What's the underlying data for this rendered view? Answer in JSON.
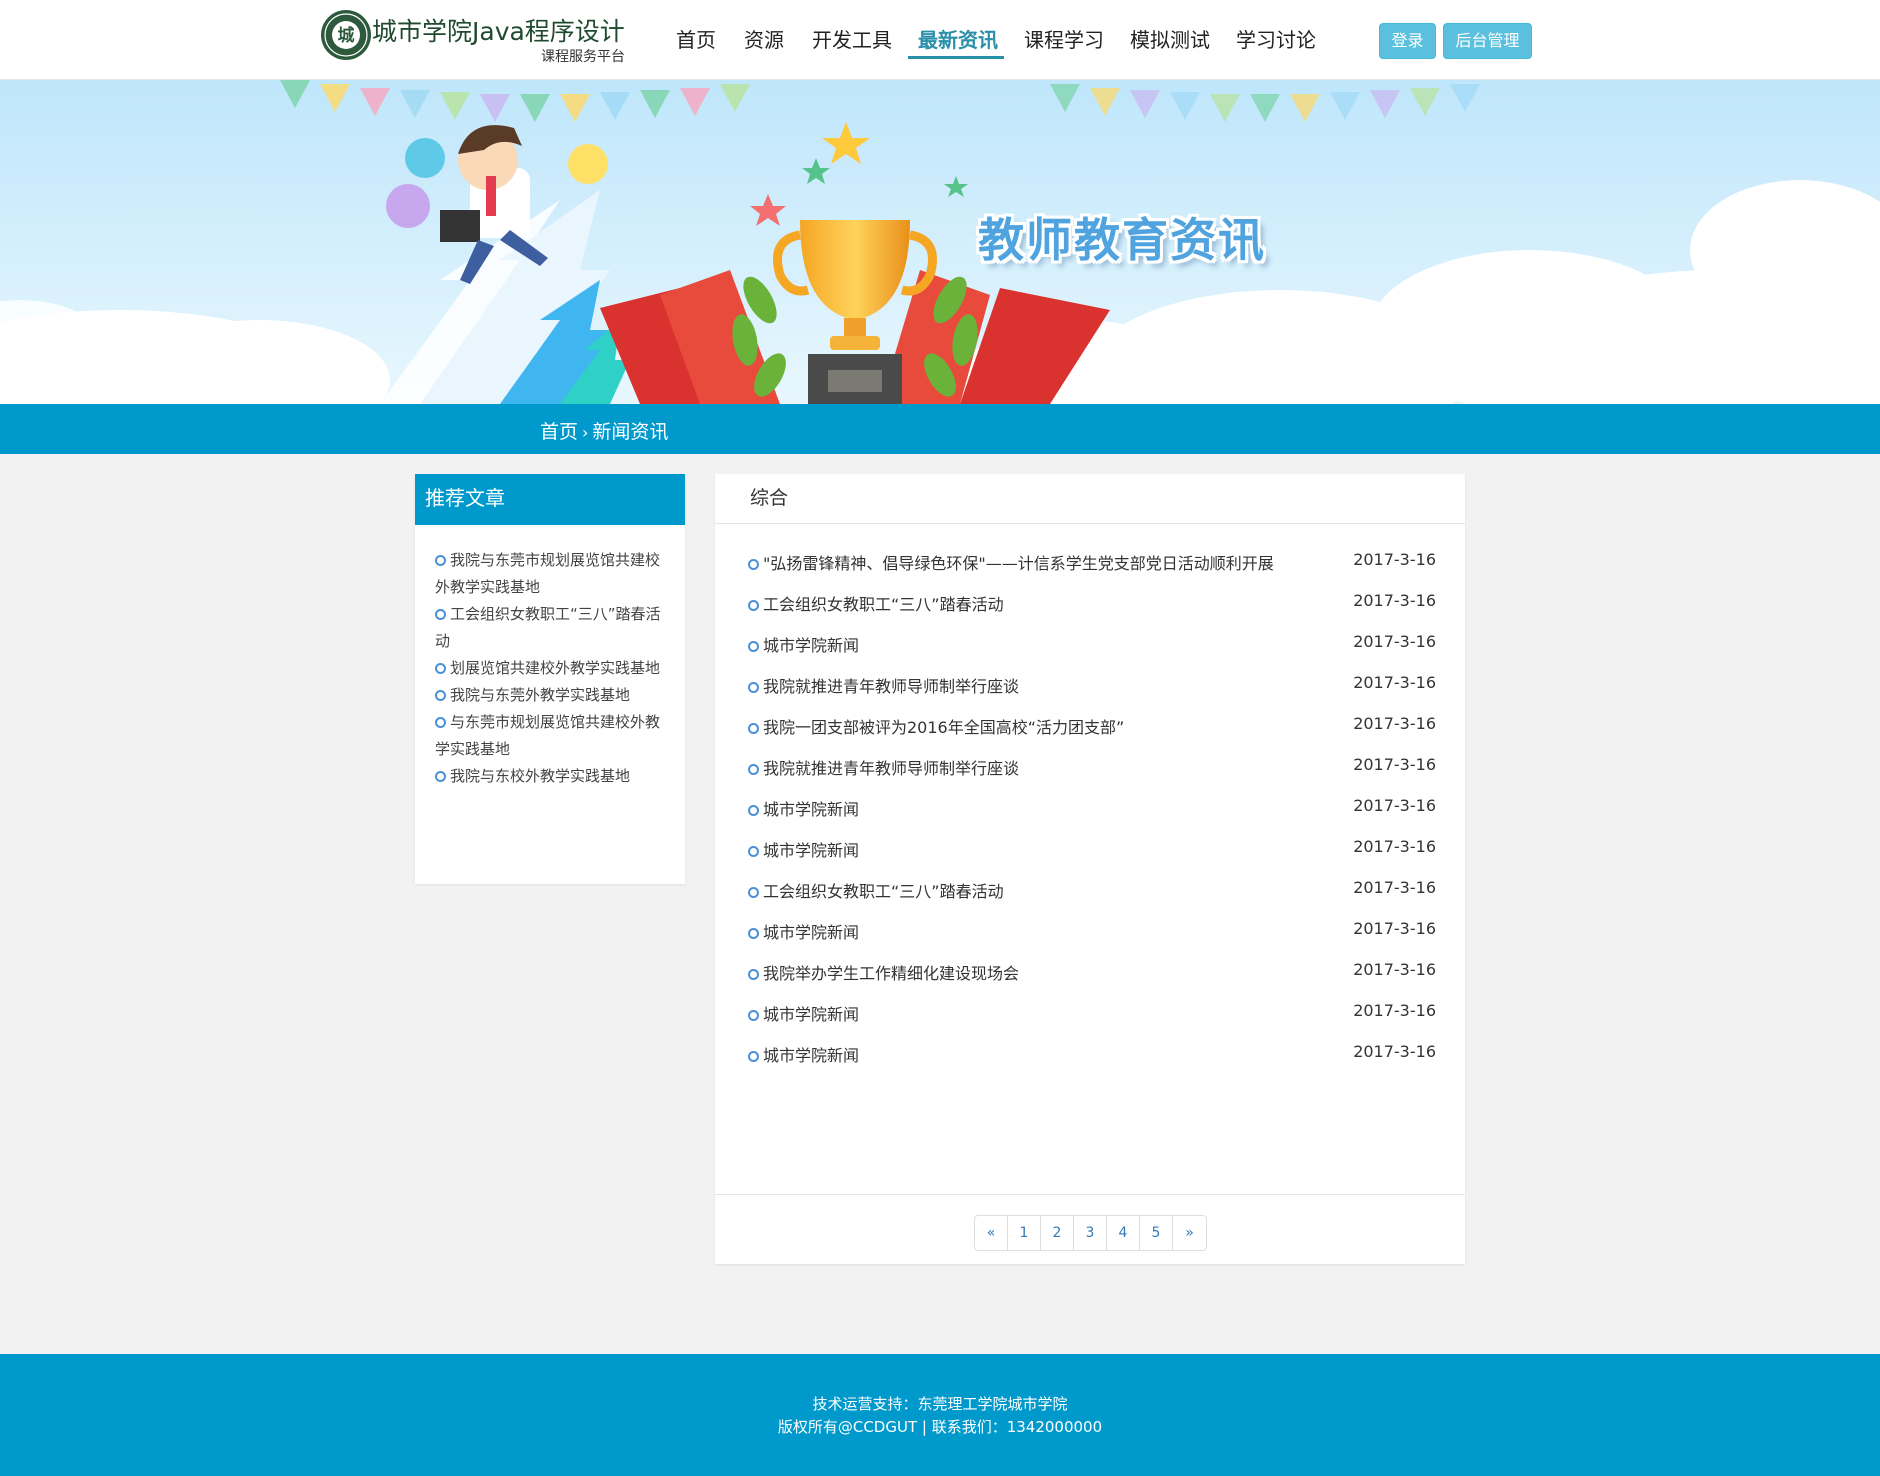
{
  "header": {
    "site_title": "城市学院Java程序设计",
    "site_subtitle": "课程服务平台",
    "logo_text": "城",
    "nav": [
      {
        "label": "首页"
      },
      {
        "label": "资源"
      },
      {
        "label": "开发工具"
      },
      {
        "label": "最新资讯",
        "active": true
      },
      {
        "label": "课程学习"
      },
      {
        "label": "模拟测试"
      },
      {
        "label": "学习讨论"
      }
    ],
    "login_label": "登录",
    "admin_label": "后台管理"
  },
  "banner": {
    "title": "教师教育资讯"
  },
  "breadcrumb": {
    "home": "首页",
    "separator": "›",
    "current": "新闻资讯"
  },
  "sidebar": {
    "title": "推荐文章",
    "items": [
      {
        "label": "我院与东莞市规划展览馆共建校外教学实践基地"
      },
      {
        "label": "工会组织女教职工“三八”踏春活动"
      },
      {
        "label": "划展览馆共建校外教学实践基地"
      },
      {
        "label": "我院与东莞外教学实践基地"
      },
      {
        "label": "与东莞市规划展览馆共建校外教学实践基地"
      },
      {
        "label": "我院与东校外教学实践基地"
      }
    ]
  },
  "main": {
    "category": "综合",
    "news": [
      {
        "title": "\"弘扬雷锋精神、倡导绿色环保\"——计信系学生党支部党日活动顺利开展",
        "date": "2017-3-16"
      },
      {
        "title": "工会组织女教职工“三八”踏春活动",
        "date": "2017-3-16"
      },
      {
        "title": "城市学院新闻",
        "date": "2017-3-16"
      },
      {
        "title": "我院就推进青年教师导师制举行座谈",
        "date": "2017-3-16"
      },
      {
        "title": "我院一团支部被评为2016年全国高校“活力团支部”",
        "date": "2017-3-16"
      },
      {
        "title": "我院就推进青年教师导师制举行座谈",
        "date": "2017-3-16"
      },
      {
        "title": "城市学院新闻",
        "date": "2017-3-16"
      },
      {
        "title": "城市学院新闻",
        "date": "2017-3-16"
      },
      {
        "title": "工会组织女教职工“三八”踏春活动",
        "date": "2017-3-16"
      },
      {
        "title": "城市学院新闻",
        "date": "2017-3-16"
      },
      {
        "title": "我院举办学生工作精细化建设现场会",
        "date": "2017-3-16"
      },
      {
        "title": "城市学院新闻",
        "date": "2017-3-16"
      },
      {
        "title": "城市学院新闻",
        "date": "2017-3-16"
      }
    ],
    "pagination": [
      "«",
      "1",
      "2",
      "3",
      "4",
      "5",
      "»"
    ]
  },
  "footer": {
    "line1": "技术运营支持：东莞理工学院城市学院",
    "line2": "版权所有@CCDGUT | 联系我们：1342000000"
  },
  "colors": {
    "primary": "#0099cc",
    "nav_active": "#2a8fa8",
    "button": "#5bc0de",
    "link": "#337ab7"
  }
}
